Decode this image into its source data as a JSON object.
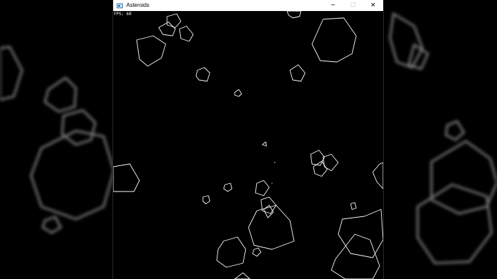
{
  "window": {
    "title": "Asteroids",
    "minimize_glyph": "─",
    "maximize_glyph": "☐",
    "close_glyph": "✕",
    "icon": "app-window-icon"
  },
  "hud": {
    "fps_label": "FPS:",
    "fps_value": "60"
  },
  "colors": {
    "background": "#000000",
    "asteroid_stroke": "#ffffff",
    "titlebar": "#ffffff"
  }
}
